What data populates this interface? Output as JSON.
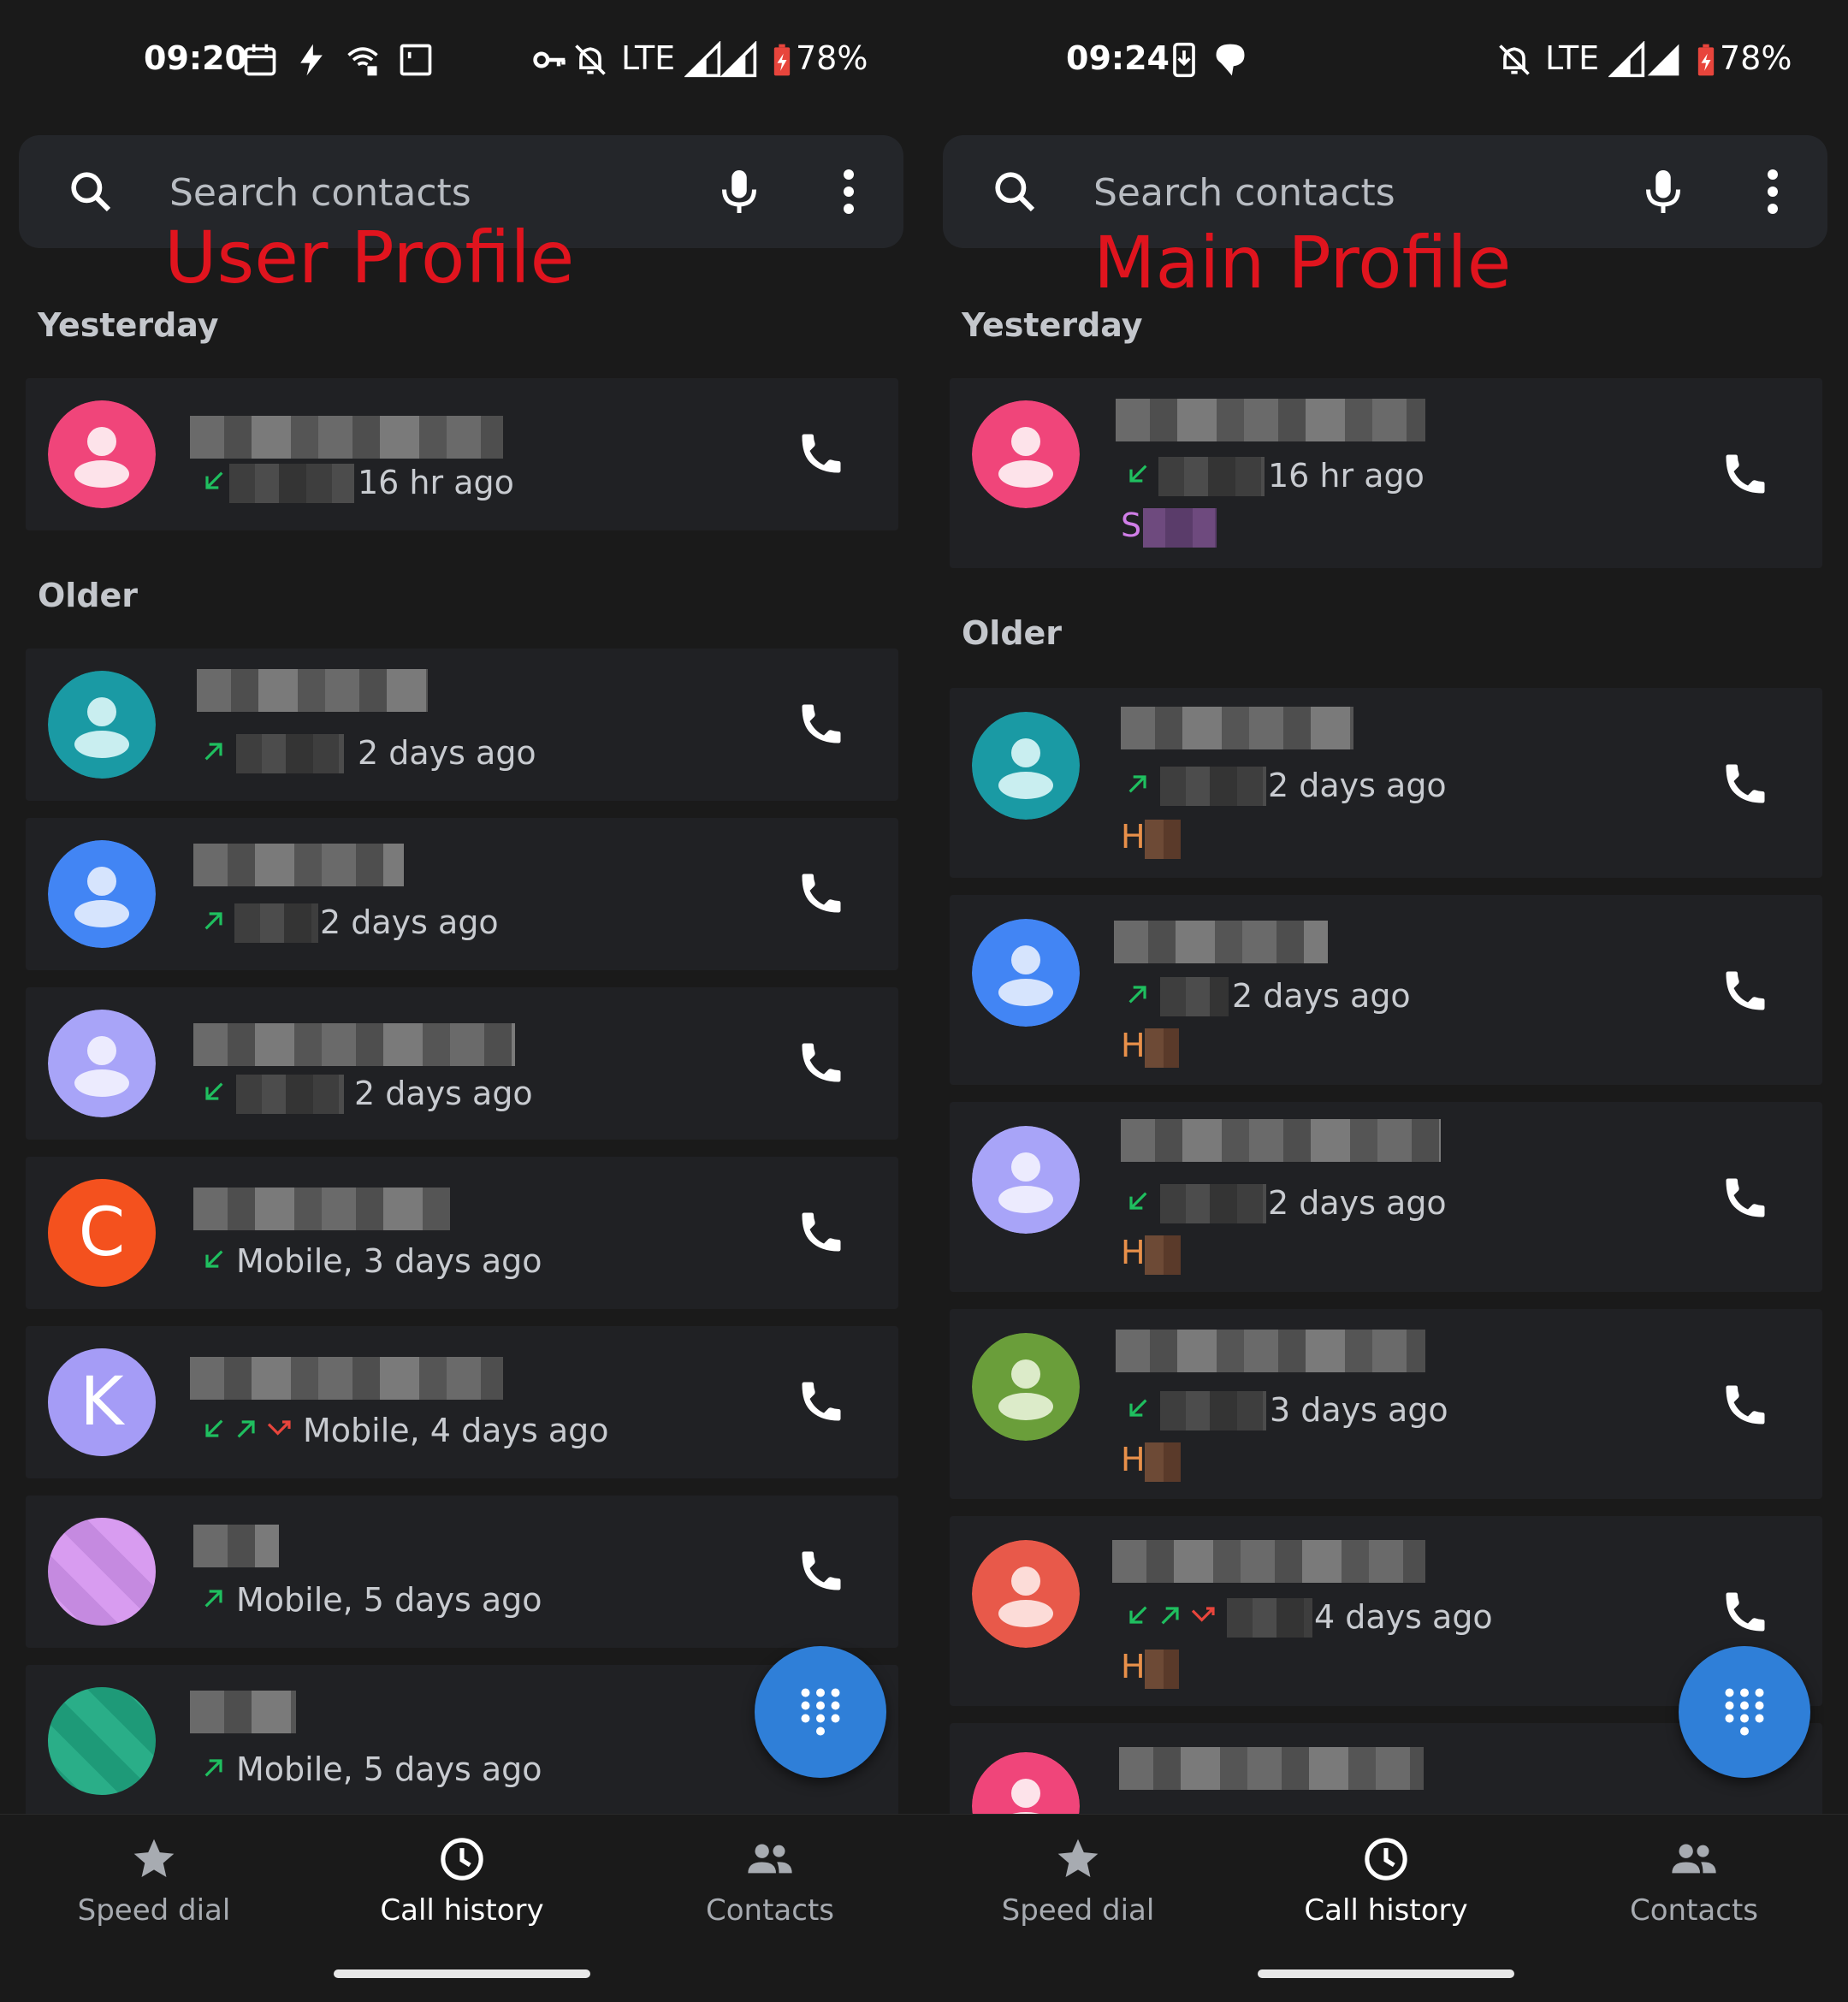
{
  "left": {
    "status": {
      "time": "09:20",
      "network": "LTE",
      "battery": "78%"
    },
    "search": {
      "placeholder": "Search contacts"
    },
    "profile_label": "User Profile",
    "sections": {
      "yesterday": "Yesterday",
      "older": "Older"
    },
    "calls": [
      {
        "meta": "16 hr ago",
        "avatar_color": "#f0457a",
        "direction": "incoming"
      },
      {
        "meta": "2 days ago",
        "avatar_color": "#1a9aa4",
        "direction": "outgoing"
      },
      {
        "meta": "2 days ago",
        "avatar_color": "#4285f4",
        "direction": "outgoing"
      },
      {
        "meta": "2 days ago",
        "avatar_color": "#a8a4f8",
        "direction": "incoming"
      },
      {
        "meta": "Mobile, 3 days ago",
        "avatar_color": "#f4511e",
        "avatar_letter": "C",
        "direction": "incoming"
      },
      {
        "meta": "Mobile, 4 days ago",
        "avatar_color": "#a59cf6",
        "avatar_letter": "K",
        "direction": "incoming,outgoing,missed"
      },
      {
        "meta": "Mobile, 5 days ago",
        "avatar_color": "#d89cf0",
        "direction": "outgoing"
      },
      {
        "meta": "Mobile, 5 days ago",
        "avatar_color": "#1e9a78",
        "direction": "outgoing"
      }
    ]
  },
  "right": {
    "status": {
      "time": "09:24",
      "network": "LTE",
      "battery": "78%"
    },
    "search": {
      "placeholder": "Search contacts"
    },
    "profile_label": "Main Profile",
    "sections": {
      "yesterday": "Yesterday",
      "older": "Older"
    },
    "calls": [
      {
        "meta": "16 hr ago",
        "avatar_color": "#f0457a",
        "direction": "incoming",
        "sub_letter": "S",
        "sub_color": "#d07ee8"
      },
      {
        "meta": "2 days ago",
        "avatar_color": "#1a9aa4",
        "direction": "outgoing",
        "sub_letter": "H",
        "sub_color": "#e8904a"
      },
      {
        "meta": "2 days ago",
        "avatar_color": "#4285f4",
        "direction": "outgoing",
        "sub_letter": "H",
        "sub_color": "#e8904a"
      },
      {
        "meta": "2 days ago",
        "avatar_color": "#a8a4f8",
        "direction": "incoming",
        "sub_letter": "H",
        "sub_color": "#e8904a"
      },
      {
        "meta": "3 days ago",
        "avatar_color": "#6a9e3a",
        "direction": "incoming",
        "sub_letter": "H",
        "sub_color": "#e8904a"
      },
      {
        "meta": "4 days ago",
        "avatar_color": "#e8594a",
        "direction": "incoming,outgoing,missed",
        "sub_letter": "H",
        "sub_color": "#e8904a"
      },
      {
        "meta": "",
        "avatar_color": "#f0457a",
        "direction": ""
      }
    ]
  },
  "nav": {
    "speed_dial": "Speed dial",
    "call_history": "Call history",
    "contacts": "Contacts"
  },
  "colors": {
    "background": "#1a1a1a",
    "card": "#202124",
    "accent": "#2f7fd8",
    "incoming": "#1fbf5f",
    "missed": "#e8453c",
    "label_red": "#e0141e"
  }
}
